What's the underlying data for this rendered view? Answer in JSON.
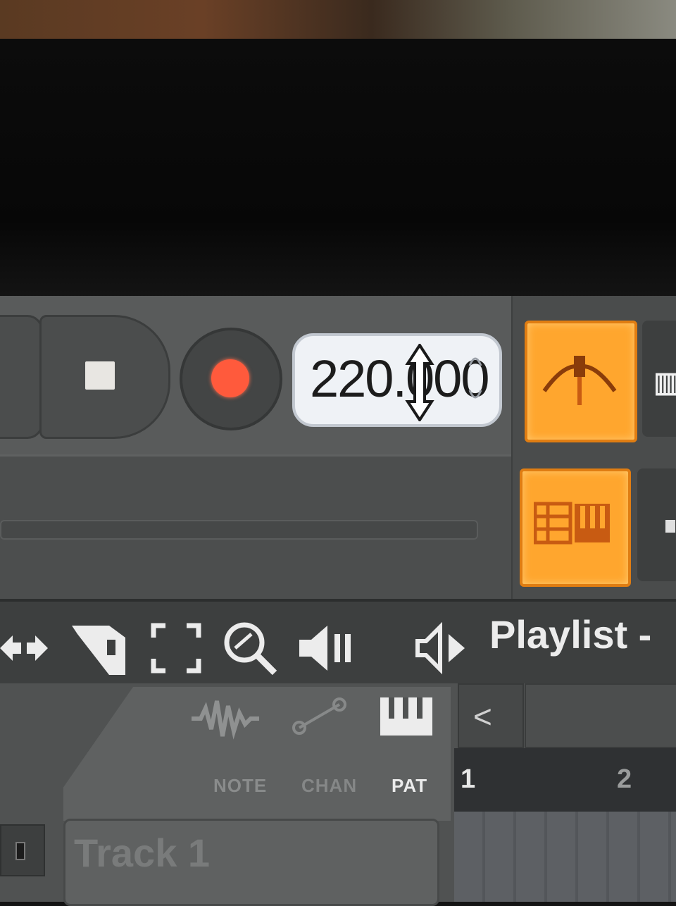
{
  "transport": {
    "tempo_value": "220.000",
    "record_color": "#ff5a3c"
  },
  "toolbar": {
    "icons": [
      "arrows-icon",
      "paint-brush-icon",
      "select-icon",
      "zoom-icon",
      "speaker-icon",
      "audio-preview-icon"
    ]
  },
  "playlist": {
    "title": "Playlist -"
  },
  "track_panel": {
    "tab_labels": {
      "note": "NOTE",
      "chan": "CHAN",
      "pat": "PAT"
    },
    "timeline": {
      "bar_1": "1",
      "bar_2": "2"
    },
    "tracks": [
      {
        "name": "Track 1"
      }
    ],
    "scroll_left": "<"
  },
  "colors": {
    "accent_orange": "#ffa62e",
    "panel_gray": "#545656"
  }
}
